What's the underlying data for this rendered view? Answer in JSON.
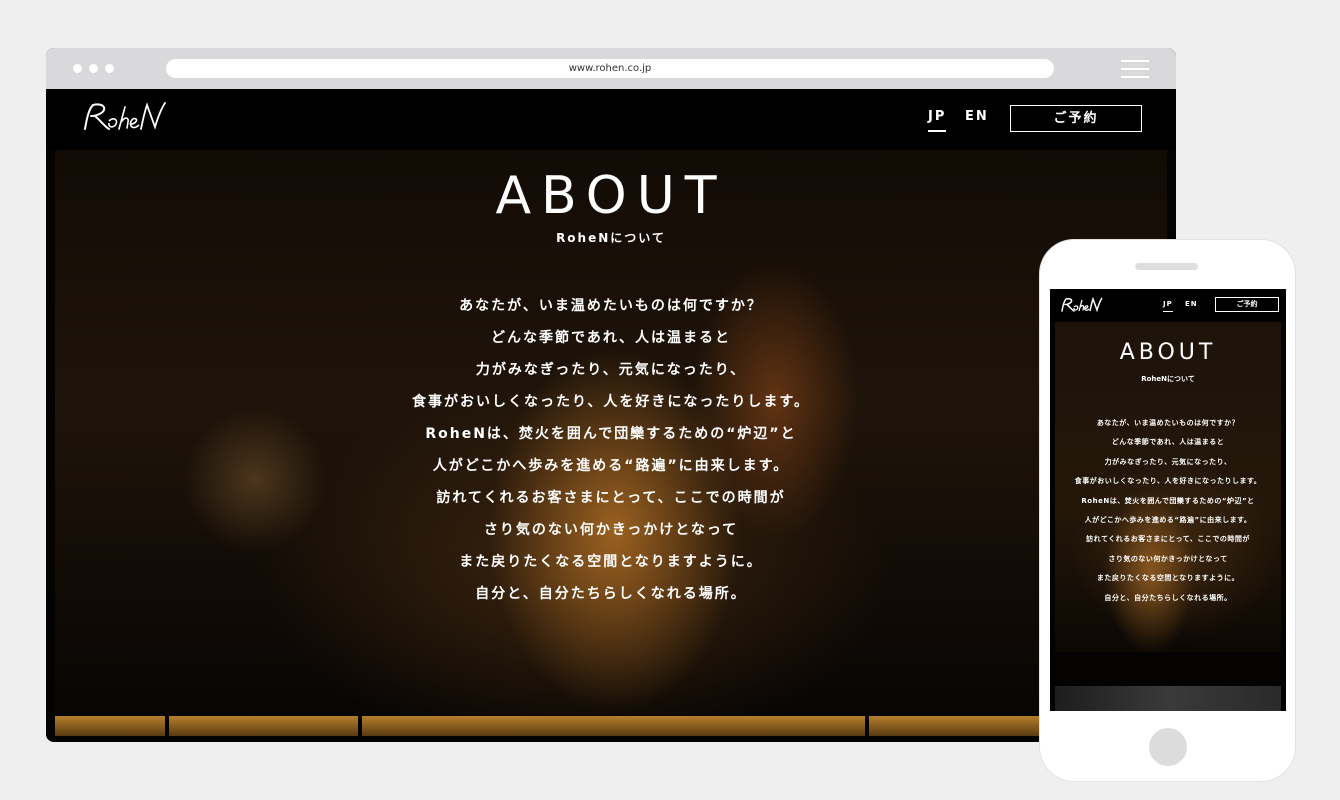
{
  "browser": {
    "url": "www.rohen.co.jp",
    "window_dots": [
      "dot",
      "dot",
      "dot"
    ]
  },
  "site": {
    "logo_text": "RoheN",
    "lang_jp": "JP",
    "lang_en": "EN",
    "reserve_label": "ご予約",
    "about": {
      "title": "ABOUT",
      "subtitle": "RoheNについて",
      "lines": [
        "あなたが、いま温めたいものは何ですか？",
        "どんな季節であれ、人は温まると",
        "力がみなぎったり、元気になったり、",
        "食事がおいしくなったり、人を好きになったりします。",
        "RoheNは、焚火を囲んで団欒するための“炉辺”と",
        "人がどこかへ歩みを進める“路遍”に由来します。",
        "訪れてくれるお客さまにとって、ここでの時間が",
        "さり気のない何かきっかけとなって",
        "また戻りたくなる空間となりますように。",
        "自分と、自分たちらしくなれる場所。"
      ]
    }
  },
  "colors": {
    "page_bg": "#efeff0",
    "browser_chrome": "#d9d9db",
    "site_bg": "#000000",
    "ember_accent": "#b5802e",
    "text": "#ffffff"
  },
  "icons": {
    "menu": "hamburger-menu-icon",
    "logo": "rohen-script-logo"
  }
}
